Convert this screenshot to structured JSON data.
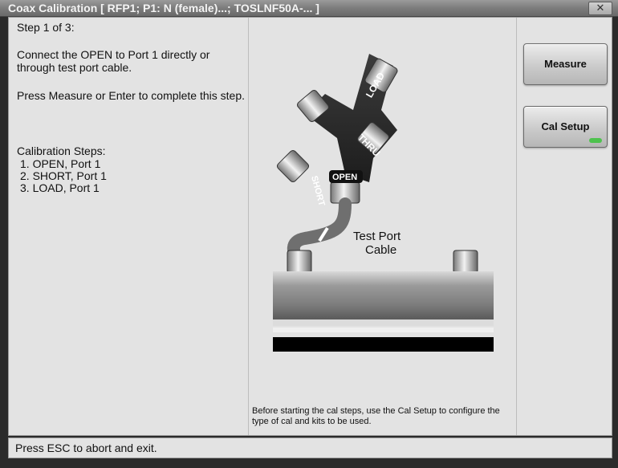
{
  "window": {
    "title": "Coax Calibration [ RFP1; P1: N (female)...; TOSLNF50A-... ]",
    "close_glyph": "✕"
  },
  "instructions": {
    "step": "Step 1 of 3:",
    "connect": "Connect the OPEN to Port 1 directly or through test port cable.",
    "press": "Press Measure or Enter to complete this step.",
    "steps_heading": "Calibration Steps:",
    "steps": [
      "1. OPEN, Port 1",
      "2. SHORT, Port 1",
      "3. LOAD, Port 1"
    ]
  },
  "diagram": {
    "labels": {
      "load": "LOAD",
      "thru": "THRU",
      "short": "SHORT",
      "open": "OPEN",
      "cable": "Test Port",
      "cable2": "Cable"
    },
    "note": "Before starting the cal steps, use the Cal Setup to configure the type of cal and kits to be used."
  },
  "buttons": {
    "measure": "Measure",
    "cal_setup": "Cal Setup"
  },
  "status": {
    "text": "Press ESC to abort and exit."
  },
  "colors": {
    "indicator": "#4ec24e"
  }
}
